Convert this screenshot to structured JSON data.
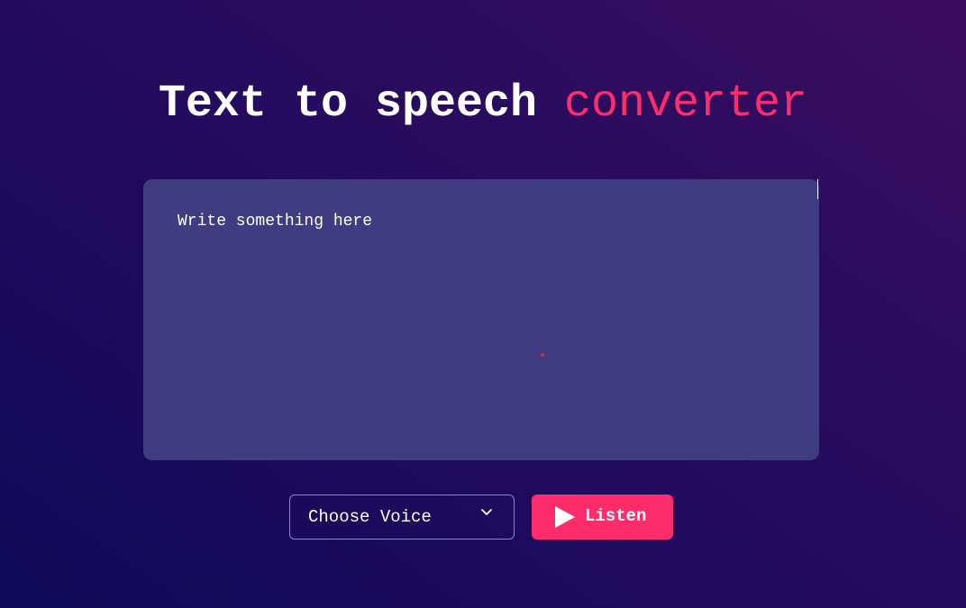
{
  "header": {
    "title_main": "Text to speech",
    "title_accent": "converter"
  },
  "text_input": {
    "placeholder": "Write something here",
    "value": ""
  },
  "voice_select": {
    "selected_label": "Choose Voice",
    "icon": "chevron-down-icon"
  },
  "listen_button": {
    "label": "Listen",
    "icon": "play-icon"
  },
  "colors": {
    "accent": "#ff2c6b",
    "textarea_bg": "#3f3c82",
    "select_border": "#8b84d6",
    "background_start": "#110a5a",
    "background_end": "#3c0d5f"
  }
}
